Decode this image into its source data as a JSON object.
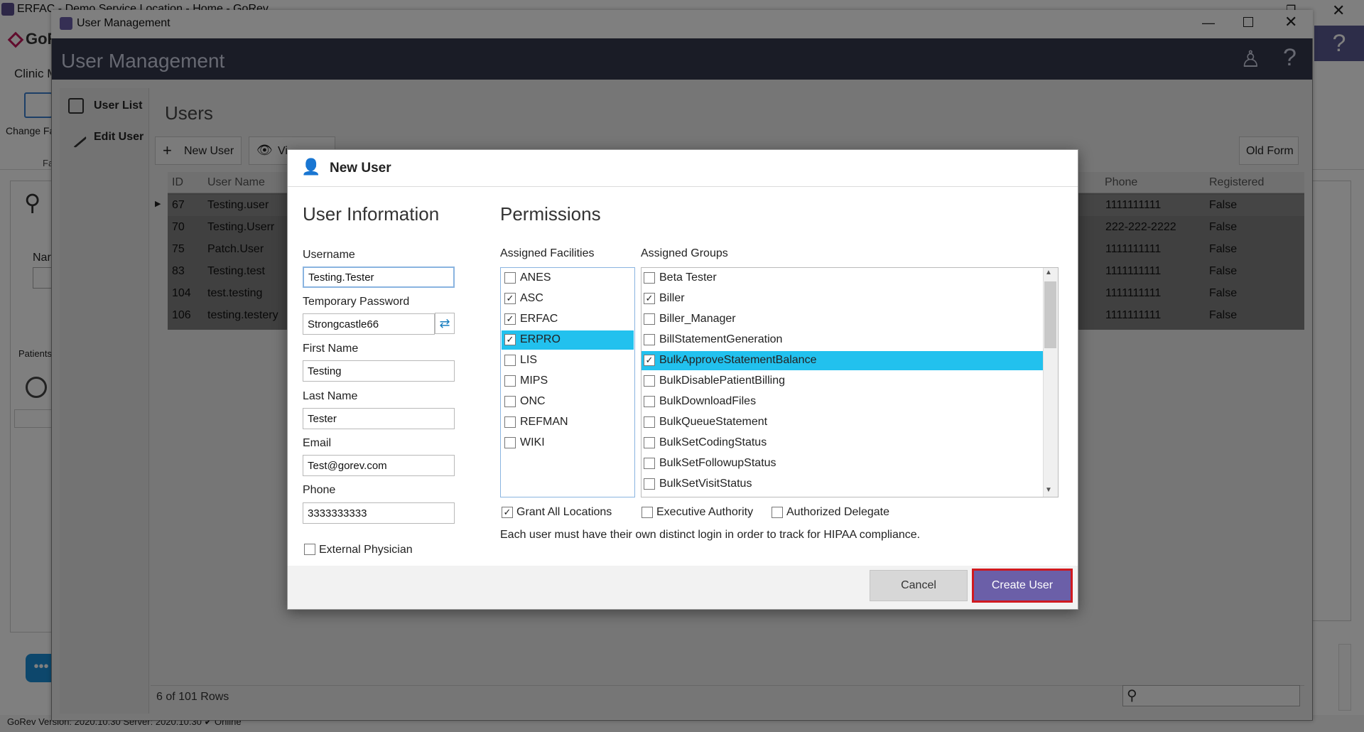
{
  "background_app": {
    "window_title": "ERFAC - Demo Service Location - Home - GoRev",
    "logo_text": "GoR",
    "help_icon": "?",
    "ribbon_group_label": "Clinic M",
    "change_button_label": "Change Fa",
    "ribbon_section_label": "Fa",
    "name_label": "Nar",
    "patients_label": "Patients",
    "status_bar": "GoRev Version: 2020.10.30    Server: 2020.10.30    ✔ Online"
  },
  "window": {
    "title": "User Management",
    "header_title": "User Management",
    "minimize": "—",
    "close": "✕"
  },
  "sidebar": {
    "items": [
      {
        "label": "User List",
        "icon": "clipboard-icon"
      },
      {
        "label": "Edit User",
        "icon": "pencil-icon"
      }
    ]
  },
  "main": {
    "title": "Users",
    "toolbar": {
      "new_user": "New User",
      "view": "Vi",
      "old_form": "Old Form"
    },
    "grid": {
      "columns": [
        "ID",
        "User Name",
        "Phone",
        "Registered"
      ],
      "rows": [
        {
          "id": "67",
          "user_name": "Testing.user",
          "phone": "1111111111",
          "registered": "False"
        },
        {
          "id": "70",
          "user_name": "Testing.Userr",
          "phone": "222-222-2222",
          "registered": "False"
        },
        {
          "id": "75",
          "user_name": "Patch.User",
          "phone": "1111111111",
          "registered": "False"
        },
        {
          "id": "83",
          "user_name": "Testing.test",
          "phone": "1111111111",
          "registered": "False"
        },
        {
          "id": "104",
          "user_name": "test.testing",
          "phone": "1111111111",
          "registered": "False"
        },
        {
          "id": "106",
          "user_name": "testing.testery",
          "phone": "1111111111",
          "registered": "False"
        }
      ]
    },
    "row_count": "6 of 101 Rows"
  },
  "dialog": {
    "title": "New User",
    "user_info_heading": "User Information",
    "permissions_heading": "Permissions",
    "fields": {
      "username_label": "Username",
      "username_value": "Testing.Tester",
      "temp_password_label": "Temporary Password",
      "temp_password_value": "Strongcastle66",
      "first_name_label": "First Name",
      "first_name_value": "Testing",
      "last_name_label": "Last Name",
      "last_name_value": "Tester",
      "email_label": "Email",
      "email_value": "Test@gorev.com",
      "phone_label": "Phone",
      "phone_value": "3333333333",
      "external_physician_label": "External Physician",
      "external_physician_checked": false
    },
    "facilities_label": "Assigned Facilities",
    "facilities": [
      {
        "name": "ANES",
        "checked": false,
        "selected": false
      },
      {
        "name": "ASC",
        "checked": true,
        "selected": false
      },
      {
        "name": "ERFAC",
        "checked": true,
        "selected": false
      },
      {
        "name": "ERPRO",
        "checked": true,
        "selected": true
      },
      {
        "name": "LIS",
        "checked": false,
        "selected": false
      },
      {
        "name": "MIPS",
        "checked": false,
        "selected": false
      },
      {
        "name": "ONC",
        "checked": false,
        "selected": false
      },
      {
        "name": "REFMAN",
        "checked": false,
        "selected": false
      },
      {
        "name": "WIKI",
        "checked": false,
        "selected": false
      }
    ],
    "groups_label": "Assigned Groups",
    "groups": [
      {
        "name": "Beta Tester",
        "checked": false,
        "selected": false
      },
      {
        "name": "Biller",
        "checked": true,
        "selected": false
      },
      {
        "name": "Biller_Manager",
        "checked": false,
        "selected": false
      },
      {
        "name": "BillStatementGeneration",
        "checked": false,
        "selected": false
      },
      {
        "name": "BulkApproveStatementBalance",
        "checked": true,
        "selected": true
      },
      {
        "name": "BulkDisablePatientBilling",
        "checked": false,
        "selected": false
      },
      {
        "name": "BulkDownloadFiles",
        "checked": false,
        "selected": false
      },
      {
        "name": "BulkQueueStatement",
        "checked": false,
        "selected": false
      },
      {
        "name": "BulkSetCodingStatus",
        "checked": false,
        "selected": false
      },
      {
        "name": "BulkSetFollowupStatus",
        "checked": false,
        "selected": false
      },
      {
        "name": "BulkSetVisitStatus",
        "checked": false,
        "selected": false
      }
    ],
    "grant_all_locations_label": "Grant All Locations",
    "grant_all_locations_checked": true,
    "executive_authority_label": "Executive Authority",
    "executive_authority_checked": false,
    "authorized_delegate_label": "Authorized Delegate",
    "authorized_delegate_checked": false,
    "hipaa_note": "Each user must have their own distinct login in order to track for HIPAA compliance.",
    "cancel_label": "Cancel",
    "create_label": "Create User"
  },
  "colors": {
    "header_bg": "#35384d",
    "selection": "#22c1ee",
    "create_button": "#6b5fa8",
    "highlight_border": "#d0191f"
  }
}
